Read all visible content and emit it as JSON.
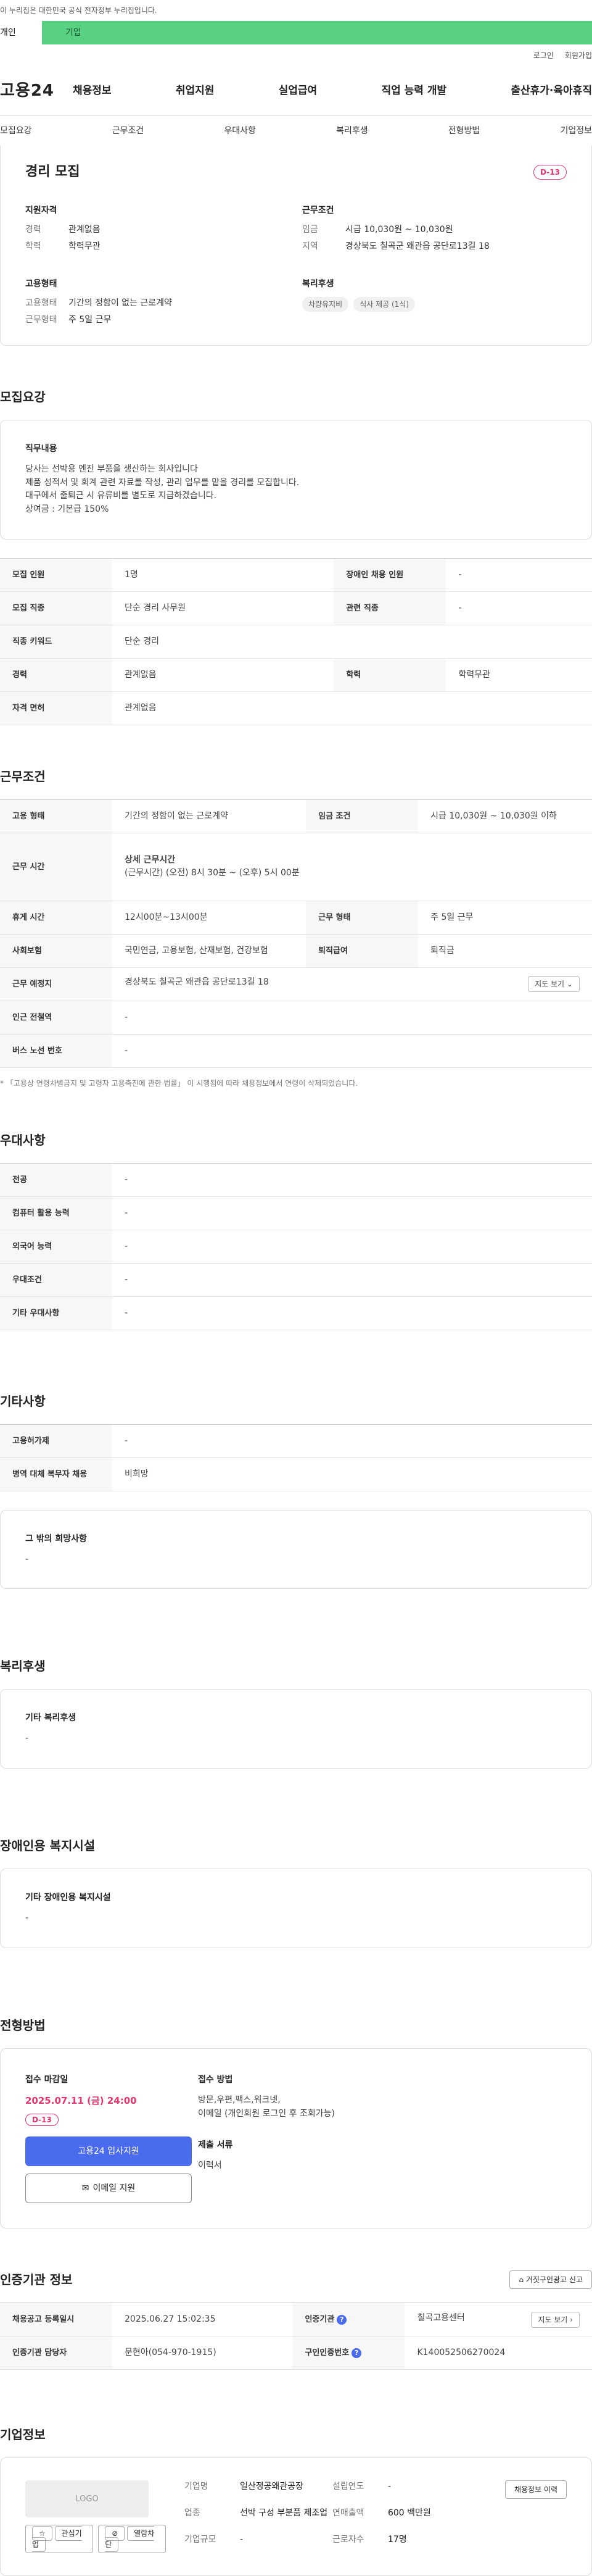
{
  "top_notice": "이 누리집은 대한민국 공식 전자정부 누리집입니다.",
  "user_tabs": [
    "개인",
    "기업"
  ],
  "util": [
    "로그인",
    "회원가입"
  ],
  "logo": "고용24",
  "gnb": [
    "채용정보",
    "취업지원",
    "실업급여",
    "직업 능력 개발",
    "출산휴가·육아휴직"
  ],
  "subtabs": [
    "모집요강",
    "근무조건",
    "우대사항",
    "복리후생",
    "전형방법",
    "기업정보"
  ],
  "summary": {
    "title": "경리 모집",
    "dday": "D-13",
    "qualification": {
      "heading": "지원자격",
      "career_k": "경력",
      "career_v": "관계없음",
      "edu_k": "학력",
      "edu_v": "학력무관"
    },
    "conditions": {
      "heading": "근무조건",
      "wage_k": "임금",
      "wage_v": "시급 10,030원 ~ 10,030원",
      "region_k": "지역",
      "region_v": "경상북도 칠곡군 왜관읍 공단로13길 18"
    },
    "employment": {
      "heading": "고용형태",
      "type_k": "고용형태",
      "type_v": "기간의 정함이 없는 근로계약",
      "shift_k": "근무형태",
      "shift_v": "주 5일 근무"
    },
    "welfare": {
      "heading": "복리후생",
      "chip1": "차량유지비",
      "chip2": "식사 제공 (1식)"
    }
  },
  "recruit": {
    "title": "모집요강",
    "job_heading": "직무내용",
    "job_text": "당사는 선박용 엔진 부품을 생산하는 회사입니다\n제품 성적서 및 회계 관련 자료를 작성, 관리 업무를 맡을 경리를 모집합니다.\n대구에서 출퇴근 시 유류비를 별도로 지급하겠습니다.\n상여금 : 기본급 150%",
    "rows": [
      {
        "k1": "모집 인원",
        "v1": "1명",
        "k2": "장애인 채용 인원",
        "v2": "-"
      },
      {
        "k1": "모집 직종",
        "v1": "단순 경리 사무원",
        "k2": "관련 직종",
        "v2": "-"
      },
      {
        "k1": "직종 키워드",
        "v1": "단순 경리"
      },
      {
        "k1": "경력",
        "v1": "관계없음",
        "k2": "학력",
        "v2": "학력무관"
      },
      {
        "k1": "자격 면허",
        "v1": "관계없음"
      }
    ]
  },
  "work": {
    "title": "근무조건",
    "emp_type_k": "고용 형태",
    "emp_type_v": "기간의 정함이 없는 근로계약",
    "wage_k": "임금 조건",
    "wage_v": "시급 10,030원 ~ 10,030원 이하",
    "hours_k": "근무 시간",
    "hours_title": "상세 근무시간",
    "hours_v": "(근무시간) (오전) 8시 30분 ~ (오후) 5시 00분",
    "break_k": "휴게 시간",
    "break_v": "12시00분~13시00분",
    "shift_k": "근무 형태",
    "shift_v": "주 5일 근무",
    "insurance_k": "사회보험",
    "insurance_v": "국민연금, 고용보험, 산재보험, 건강보험",
    "severance_k": "퇴직급여",
    "severance_v": "퇴직금",
    "place_k": "근무 예정지",
    "place_v": "경상북도 칠곡군 왜관읍 공단로13길 18",
    "map_btn": "지도 보기",
    "subway_k": "인근 전철역",
    "subway_v": "-",
    "bus_k": "버스 노선 번호",
    "bus_v": "-",
    "note": "* 「고용상 연령차별금지 및 고령자 고용촉진에 관한 법률」 이 시행됨에 따라 채용정보에서 연령이 삭제되었습니다."
  },
  "preference": {
    "title": "우대사항",
    "rows": [
      {
        "k": "전공",
        "v": "-"
      },
      {
        "k": "컴퓨터 활용 능력",
        "v": "-"
      },
      {
        "k": "외국어 능력",
        "v": "-"
      },
      {
        "k": "우대조건",
        "v": "-"
      },
      {
        "k": "기타 우대사항",
        "v": "-"
      }
    ]
  },
  "etc": {
    "title": "기타사항",
    "rows": [
      {
        "k": "고용허가제",
        "v": "-"
      },
      {
        "k": "병역 대체 복무자 채용",
        "v": "비희망"
      }
    ],
    "box_heading": "그 밖의 희망사항",
    "box_text": "-"
  },
  "welfare": {
    "title": "복리후생",
    "box_heading": "기타 복리후생",
    "box_text": "-"
  },
  "disability": {
    "title": "장애인용 복지시설",
    "box_heading": "기타 장애인용 복지시설",
    "box_text": "-"
  },
  "method": {
    "title": "전형방법",
    "deadline_heading": "접수 마감일",
    "deadline": "2025.07.11 (금) 24:00",
    "dday": "D-13",
    "apply_btn": "고용24 입사지원",
    "email_btn": "이메일 지원",
    "how_heading": "접수 방법",
    "how_text": "방문,우편,팩스,워크넷,\n이메일 (개인회원 로그인 후 조회가능)",
    "docs_heading": "제출 서류",
    "docs_text": "이력서"
  },
  "agency": {
    "title": "인증기관 정보",
    "report_btn": "거짓구인광고 신고",
    "reg_k": "채용공고 등록일시",
    "reg_v": "2025.06.27 15:02:35",
    "agency_k": "인증기관",
    "agency_v": "칠곡고용센터",
    "map_btn": "지도 보기",
    "staff_k": "인증기관 담당자",
    "staff_v": "문현아(054-970-1915)",
    "no_k": "구인인증번호",
    "no_v": "K140052506270024"
  },
  "company": {
    "title": "기업정보",
    "logo_text": "LOGO",
    "fav_btn": "관심기업",
    "block_btn": "열람차단",
    "name_k": "기업명",
    "name_v": "일산정공왜관공장",
    "industry_k": "업종",
    "industry_v": "선박 구성 부분품 제조업",
    "size_k": "기업규모",
    "size_v": "-",
    "year_k": "설립연도",
    "year_v": "-",
    "sales_k": "연매출액",
    "sales_v": "600 백만원",
    "workers_k": "근로자수",
    "workers_v": "17명",
    "info_btn": "채용정보 이력"
  }
}
